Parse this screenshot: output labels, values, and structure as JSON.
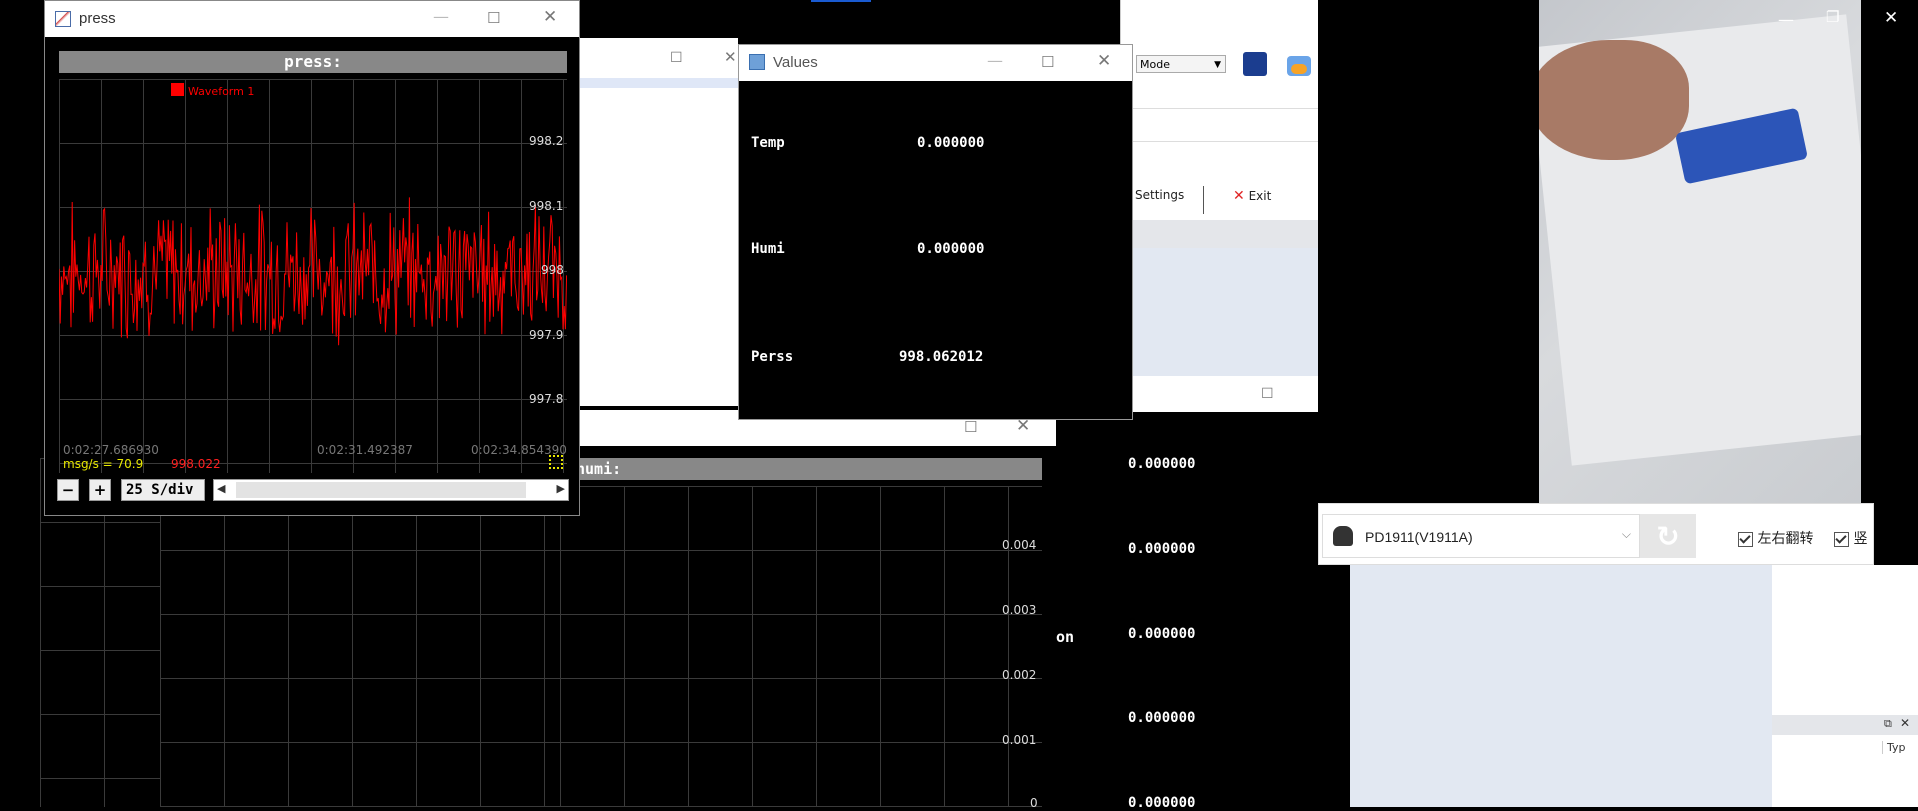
{
  "press_window": {
    "title": "press",
    "plot_title": "press:",
    "legend": "Waveform 1",
    "y_ticks": [
      "998.2",
      "998.1",
      "998",
      "997.9",
      "997.8"
    ],
    "x_ticks": [
      "0:02:27.686930",
      "0:02:31.492387",
      "0:02:34.854390"
    ],
    "msg_rate": "msg/s = 70.9",
    "last_value": "998.022",
    "zoom_minus": "−",
    "zoom_plus": "+",
    "scale": "25 S/div"
  },
  "values_window": {
    "title": "Values",
    "rows": [
      {
        "name": "Temp",
        "value": "0.000000"
      },
      {
        "name": "Humi",
        "value": "0.000000"
      },
      {
        "name": "Perss",
        "value": "998.062012"
      }
    ]
  },
  "toolbar_fragment": {
    "mode_label": "Mode",
    "settings_label": "Settings",
    "exit_label": "Exit"
  },
  "humi_window": {
    "plot_title": "numi:",
    "y_ticks": [
      "0.004",
      "0.003",
      "0.002",
      "0.001",
      "0"
    ]
  },
  "background_values": {
    "on_label": "on",
    "values": [
      "0.000000",
      "0.000000",
      "0.000000",
      "0.000000",
      "0.000000"
    ]
  },
  "mirror_app": {
    "device": "PD1911(V1911A)",
    "flip_lr_label": "左右翻转",
    "flip_v_label": "竖",
    "type_label": "Typ"
  },
  "colors": {
    "waveform": "#ff0000",
    "accent_blue": "#1a5bd1"
  }
}
